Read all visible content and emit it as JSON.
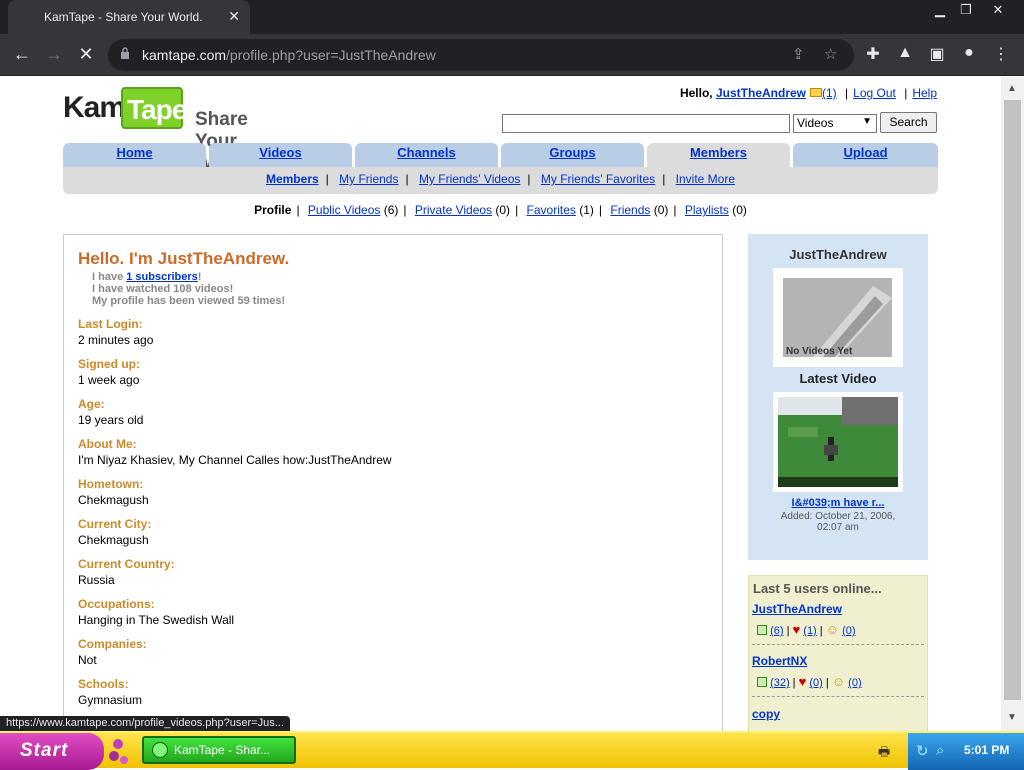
{
  "browser": {
    "tab_title": "KamTape - Share Your World.",
    "url_domain": "kamtape.com",
    "url_path": "/profile.php?user=JustTheAndrew",
    "status_url": "https://www.kamtape.com/profile_videos.php?user=Jus..."
  },
  "header": {
    "logo_left": "Kam",
    "logo_right": "Tape",
    "tagline": "Share Your World",
    "hello_label": "Hello,",
    "username": "JustTheAndrew",
    "mail_count": "(1)",
    "logout": "Log Out",
    "help": "Help",
    "search_placeholder": "",
    "search_category": "Videos",
    "search_button": "Search"
  },
  "nav": {
    "tabs": [
      "Home",
      "Videos",
      "Channels",
      "Groups",
      "Members",
      "Upload"
    ],
    "active": "Members",
    "subnav": [
      "Members",
      "My Friends",
      "My Friends' Videos",
      "My Friends' Favorites",
      "Invite More"
    ]
  },
  "profile_nav": {
    "profile": "Profile",
    "public_videos": "Public Videos",
    "public_videos_count": "(6)",
    "private_videos": "Private Videos",
    "private_videos_count": "(0)",
    "favorites": "Favorites",
    "favorites_count": "(1)",
    "friends": "Friends",
    "friends_count": "(0)",
    "playlists": "Playlists",
    "playlists_count": "(0)"
  },
  "profile": {
    "greeting": "Hello. I'm JustTheAndrew.",
    "stat_have": "I have",
    "stat_subscribers": "1 subscribers",
    "stat_subscribers_end": "!",
    "stat_watched": "I have watched 108 videos!",
    "stat_viewed": "My profile has been viewed 59 times!",
    "fields": [
      {
        "label": "Last Login:",
        "value": "2 minutes ago"
      },
      {
        "label": "Signed up:",
        "value": "1 week ago"
      },
      {
        "label": "Age:",
        "value": "19 years old"
      },
      {
        "label": "About Me:",
        "value": "I'm Niyaz Khasiev, My Channel Calles how:JustTheAndrew"
      },
      {
        "label": "Hometown:",
        "value": "Chekmagush"
      },
      {
        "label": "Current City:",
        "value": "Chekmagush"
      },
      {
        "label": "Current Country:",
        "value": "Russia"
      },
      {
        "label": "Occupations:",
        "value": "Hanging in The Swedish Wall"
      },
      {
        "label": "Companies:",
        "value": "Not"
      },
      {
        "label": "Schools:",
        "value": "Gymnasium"
      }
    ]
  },
  "sidebar": {
    "username": "JustTheAndrew",
    "no_videos": "No Videos Yet",
    "latest_label": "Latest Video",
    "video_title": "I&#039;m have r...",
    "video_added_1": "Added: October 21, 2006,",
    "video_added_2": "02:07 am"
  },
  "online": {
    "title": "Last 5 users online...",
    "users": [
      {
        "name": "JustTheAndrew",
        "videos": "(6)",
        "favs": "(1)",
        "friends": "(0)"
      },
      {
        "name": "RobertNX",
        "videos": "(32)",
        "favs": "(0)",
        "friends": "(0)"
      },
      {
        "name": "copy",
        "videos": "",
        "favs": "",
        "friends": ""
      }
    ]
  },
  "taskbar": {
    "start": "Start",
    "window": "KamTape - Shar...",
    "clock": "5:01 PM"
  }
}
